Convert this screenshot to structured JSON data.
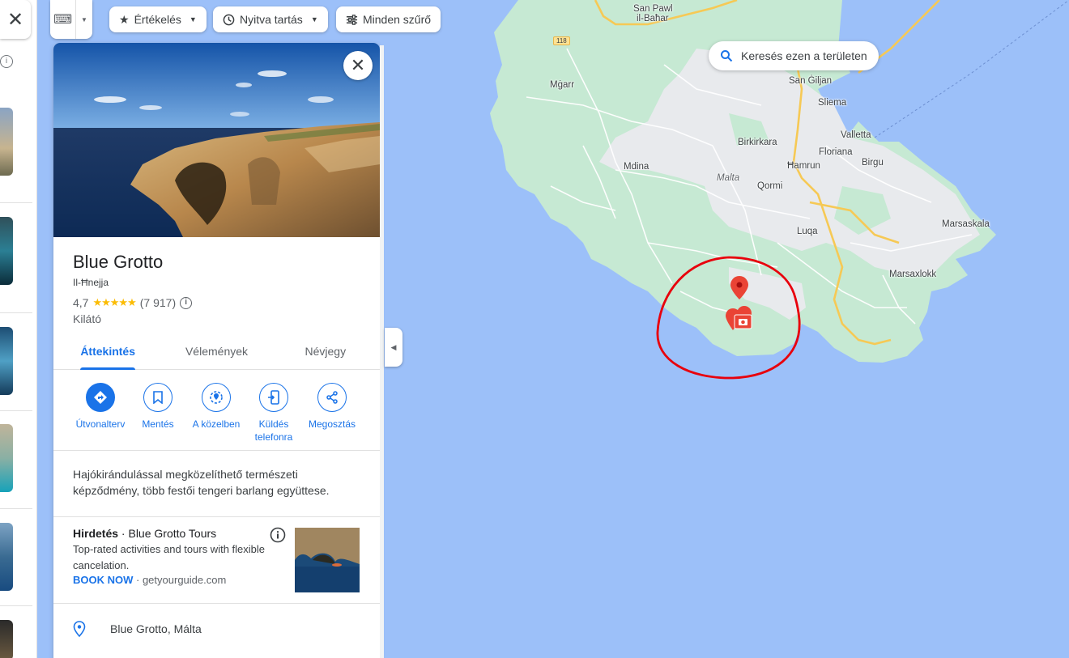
{
  "top_bar": {
    "keyboard_label": "⌨",
    "filters": [
      {
        "icon": "star-icon",
        "label": "Értékelés"
      },
      {
        "icon": "clock-icon",
        "label": "Nyitva tartás"
      },
      {
        "icon": "sliders-icon",
        "label": "Minden szűrő"
      }
    ]
  },
  "map": {
    "search_area_label": "Keresés ezen a területen",
    "road_number": "118",
    "labels": [
      {
        "text": "San Pawl",
        "italic": false
      },
      {
        "text": "il-Baħar",
        "italic": false
      },
      {
        "text": "Mġarr",
        "italic": false
      },
      {
        "text": "San Ġiljan",
        "italic": false
      },
      {
        "text": "Sliema",
        "italic": false
      },
      {
        "text": "Valletta",
        "italic": false
      },
      {
        "text": "Birkirkara",
        "italic": false
      },
      {
        "text": "Floriana",
        "italic": false
      },
      {
        "text": "Birgu",
        "italic": false
      },
      {
        "text": "Mdina",
        "italic": false
      },
      {
        "text": "Malta",
        "italic": true
      },
      {
        "text": "Ħamrun",
        "italic": false
      },
      {
        "text": "Qormi",
        "italic": false
      },
      {
        "text": "Marsaskala",
        "italic": false
      },
      {
        "text": "Luqa",
        "italic": false
      },
      {
        "text": "Marsaxlokk",
        "italic": false
      }
    ],
    "colors": {
      "water": "#9cc0f9",
      "land": "#c6e9d3",
      "urban": "#e8eaed",
      "highway": "#f8d26a",
      "annotation": "#e8000c",
      "pin": "#ea4335"
    }
  },
  "place": {
    "title": "Blue Grotto",
    "subtitle": "Il-Ħnejja",
    "rating": "4,7",
    "stars": "★★★★★",
    "review_count": "(7 917)",
    "category": "Kilátó",
    "tabs": [
      {
        "label": "Áttekintés",
        "active": true
      },
      {
        "label": "Vélemények",
        "active": false
      },
      {
        "label": "Névjegy",
        "active": false
      }
    ],
    "actions": [
      {
        "label": "Útvonalterv",
        "icon": "directions-icon"
      },
      {
        "label": "Mentés",
        "icon": "bookmark-icon"
      },
      {
        "label": "A közelben",
        "icon": "nearby-icon"
      },
      {
        "label": "Küldés telefonra",
        "icon": "send-to-phone-icon"
      },
      {
        "label": "Megosztás",
        "icon": "share-icon"
      }
    ],
    "description": "Hajókirándulással megközelíthető természeti képződmény, több festői tengeri barlang együttese.",
    "ad": {
      "tag": "Hirdetés",
      "separator": " · ",
      "advertiser": "Blue Grotto Tours",
      "text": "Top-rated activities and tours with flexible cancelation.",
      "cta": "BOOK NOW",
      "domain_sep": " · ",
      "domain": "getyourguide.com"
    },
    "address": "Blue Grotto, Málta"
  }
}
